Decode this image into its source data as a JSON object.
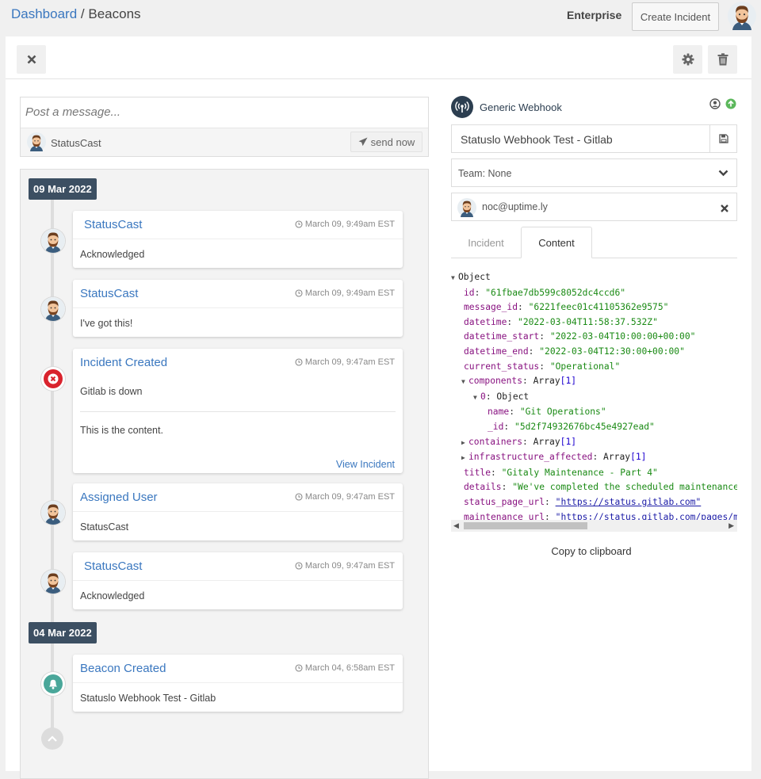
{
  "breadcrumb": {
    "root": "Dashboard",
    "separator": "/",
    "current": "Beacons"
  },
  "header": {
    "plan": "Enterprise",
    "create_label": "Create Incident"
  },
  "composer": {
    "placeholder": "Post a message...",
    "user": "StatusCast",
    "send_label": "send now"
  },
  "timeline": {
    "dates": [
      "09 Mar 2022",
      "04 Mar 2022"
    ],
    "items": [
      {
        "title": "StatusCast",
        "time": "March 09, 9:49am EST",
        "body": "Acknowledged"
      },
      {
        "title": "StatusCast",
        "time": "March 09, 9:49am EST",
        "body": "I've got this!"
      },
      {
        "title": "Incident Created",
        "time": "March 09, 9:47am EST",
        "body": "Gitlab is down",
        "body2": "This is the content.",
        "link": "View Incident"
      },
      {
        "title": "Assigned User",
        "time": "March 09, 9:47am EST",
        "body": "StatusCast"
      },
      {
        "title": "StatusCast",
        "time": "March 09, 9:47am EST",
        "body": "Acknowledged"
      },
      {
        "title": "Beacon Created",
        "time": "March 04, 6:58am EST",
        "body": "Statuslo Webhook Test - Gitlab"
      }
    ]
  },
  "webhook": {
    "title": "Generic Webhook",
    "name": "Statuslo Webhook Test - Gitlab",
    "team": "Team: None",
    "user_email": "noc@uptime.ly"
  },
  "tabs": {
    "incident": "Incident",
    "content": "Content"
  },
  "json_view": {
    "root": "Object",
    "id_key": "id",
    "id_val": "\"61fbae7db599c8052dc4ccd6\"",
    "message_id_key": "message_id",
    "message_id_val": "\"6221feec01c41105362e9575\"",
    "datetime_key": "datetime",
    "datetime_val": "\"2022-03-04T11:58:37.532Z\"",
    "datetime_start_key": "datetime_start",
    "datetime_start_val": "\"2022-03-04T10:00:00+00:00\"",
    "datetime_end_key": "datetime_end",
    "datetime_end_val": "\"2022-03-04T12:30:00+00:00\"",
    "current_status_key": "current_status",
    "current_status_val": "\"Operational\"",
    "components_key": "components",
    "components_type": "Array",
    "components_len": "[1]",
    "comp0_key": "0",
    "comp0_type": "Object",
    "comp0_name_key": "name",
    "comp0_name_val": "\"Git Operations\"",
    "comp0_id_key": "_id",
    "comp0_id_val": "\"5d2f74932676bc45e4927ead\"",
    "containers_key": "containers",
    "containers_type": "Array",
    "containers_len": "[1]",
    "infra_key": "infrastructure_affected",
    "infra_type": "Array",
    "infra_len": "[1]",
    "title_key": "title",
    "title_val": "\"Gitaly Maintenance - Part 4\"",
    "details_key": "details",
    "details_val": "\"We've completed the scheduled maintenance o",
    "status_page_url_key": "status_page_url",
    "status_page_url_val": "\"https://status.gitlab.com\"",
    "maintenance_url_key": "maintenance_url",
    "maintenance_url_val": "\"https://status.gitlab.com/pages/ma"
  },
  "copy_label": "Copy to clipboard",
  "colors": {
    "link": "#3a77bf",
    "date_badge": "#3c4f62",
    "incident_red": "#d9232d",
    "beacon_teal": "#4aa79a",
    "json_key": "#881280",
    "json_string": "#1a8a14"
  }
}
